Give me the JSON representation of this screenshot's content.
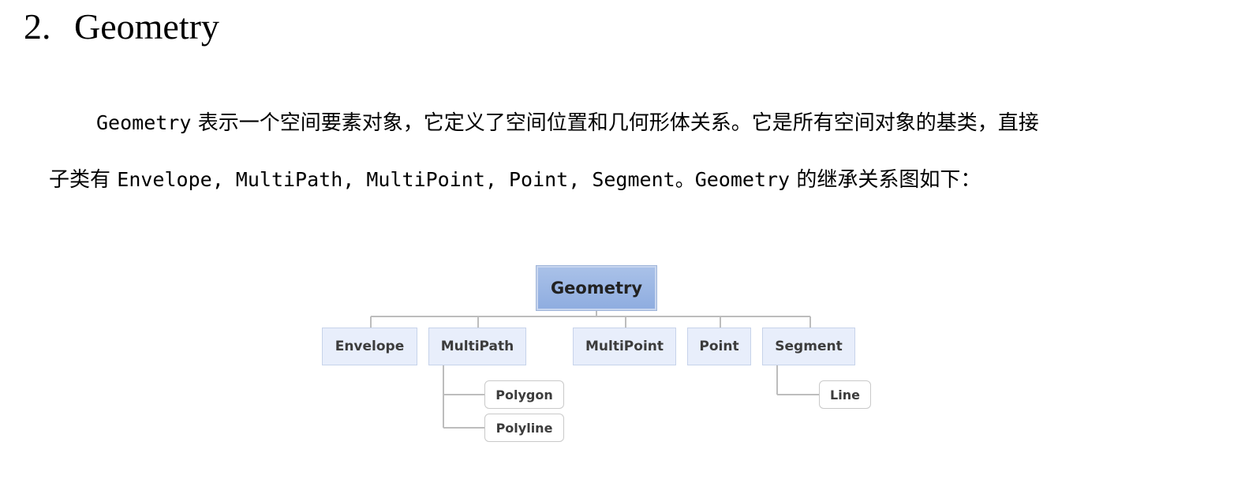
{
  "heading": {
    "number": "2.",
    "title": "Geometry"
  },
  "paragraph": {
    "line1_code": "Geometry",
    "line1_text": "表示一个空间要素对象，它定义了空间位置和几何形体关系。它是所有空间对象的基类，直接",
    "line2_prefix": "子类有",
    "line2_classes": "Envelope, MultiPath, MultiPoint, Point, Segment。Geometry",
    "line2_suffix": "的继承关系图如下："
  },
  "diagram": {
    "root": "Geometry",
    "children": [
      "Envelope",
      "MultiPath",
      "MultiPoint",
      "Point",
      "Segment"
    ],
    "multipath_children": [
      "Polygon",
      "Polyline"
    ],
    "segment_children": [
      "Line"
    ]
  }
}
